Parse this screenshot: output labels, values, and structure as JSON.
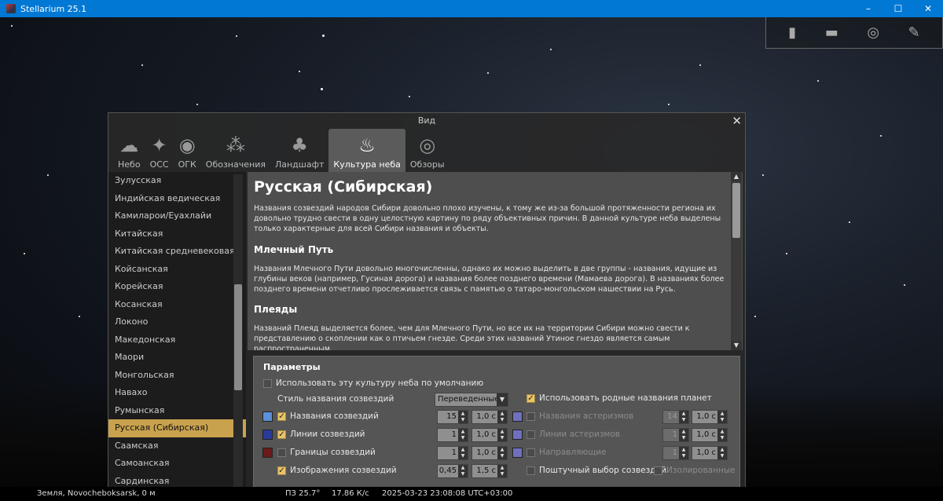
{
  "window": {
    "title": "Stellarium 25.1",
    "min": "–",
    "max": "☐",
    "close": "✕"
  },
  "toolbar": {
    "icons": [
      "trash-icon",
      "display-icon",
      "target-icon",
      "wrench-icon"
    ]
  },
  "status": {
    "location": "Земля, Novocheboksarsk, 0 м",
    "fov": "ПЗ 25.7°",
    "fps": "17.86 К/с",
    "datetime": "2025-03-23 23:08:08 UTC+03:00"
  },
  "dialog": {
    "title": "Вид",
    "close": "✕",
    "tabs": [
      {
        "label": "Небо",
        "icon": "☁"
      },
      {
        "label": "ОСС",
        "icon": "✦"
      },
      {
        "label": "ОГК",
        "icon": "◉"
      },
      {
        "label": "Обозначения",
        "icon": "⁂"
      },
      {
        "label": "Ландшафт",
        "icon": "♣"
      },
      {
        "label": "Культура неба",
        "icon": "♨"
      },
      {
        "label": "Обзоры",
        "icon": "◎"
      }
    ],
    "cultures": [
      "Зулусская",
      "Индийская ведическая",
      "Камиларои/Еуахлайи",
      "Китайская",
      "Китайская средневековая",
      "Койсанская",
      "Корейская",
      "Косанская",
      "Локоно",
      "Македонская",
      "Маори",
      "Монгольская",
      "Навахо",
      "Румынская",
      "Русская (Сибирская)",
      "Саамская",
      "Самоанская",
      "Сардинская"
    ],
    "selected_index": 14,
    "desc": {
      "title": "Русская (Сибирская)",
      "p1": "Названия созвездий народов Сибири довольно плохо изучены, к тому же из-за большой протяженности региона их довольно трудно свести в одну целостную картину по ряду объективных причин. В данной культуре неба выделены только характерные для всей Сибири названия и объекты.",
      "h_milky": "Млечный Путь",
      "p2": "Названия Млечного Пути довольно многочисленны, однако их можно выделить в две группы - названия, идущие из глубины веков (например, Гусиная дорога) и названия более позднего времени (Мамаева дорога). В названиях более позднего времени отчетливо прослеживается связь с памятью о татаро-монгольском нашествии на Русь.",
      "h_pleiades": "Плеяды",
      "p3": "Названий Плеяд выделяется более, чем для Млечного Пути, но все их на территории Сибири можно свести к представлению о скоплении как о птичьем гнезде. Среди этих названий Утиное гнездо является самым распространенным."
    },
    "params": {
      "title": "Параметры",
      "default_culture": "Использовать эту культуру неба по умолчанию",
      "style_label": "Стиль названия созвездий",
      "style_value": "Переведенные",
      "native_planets": "Использовать родные названия планет",
      "const_names": "Названия созвездий",
      "const_names_size": "15",
      "const_names_fade": "1,0 с",
      "const_lines": "Линии созвездий",
      "const_lines_w": "1",
      "const_lines_fade": "1,0 с",
      "const_bounds": "Границы созвездий",
      "const_bounds_w": "1",
      "const_bounds_fade": "1,0 с",
      "const_art": "Изображения созвездий",
      "const_art_bright": "0,45",
      "const_art_fade": "1,5 с",
      "ast_names": "Названия астеризмов",
      "ast_names_size": "14",
      "ast_names_fade": "1,0 с",
      "ast_lines": "Линии астеризмов",
      "ast_lines_w": "1",
      "ast_lines_fade": "1,0 с",
      "guides": "Направляющие",
      "guides_w": "1",
      "guides_fade": "1,0 с",
      "single_select": "Поштучный выбор созвездий",
      "isolated": "Изолированные"
    }
  },
  "colors": {
    "accent": "#c9a24e",
    "titlebar": "#0078d4",
    "names_swatch": "#5b8fd9",
    "lines_swatch": "#2a3a9a",
    "bounds_swatch": "#6a1a1a",
    "asterism_swatch": "#7070c0"
  }
}
